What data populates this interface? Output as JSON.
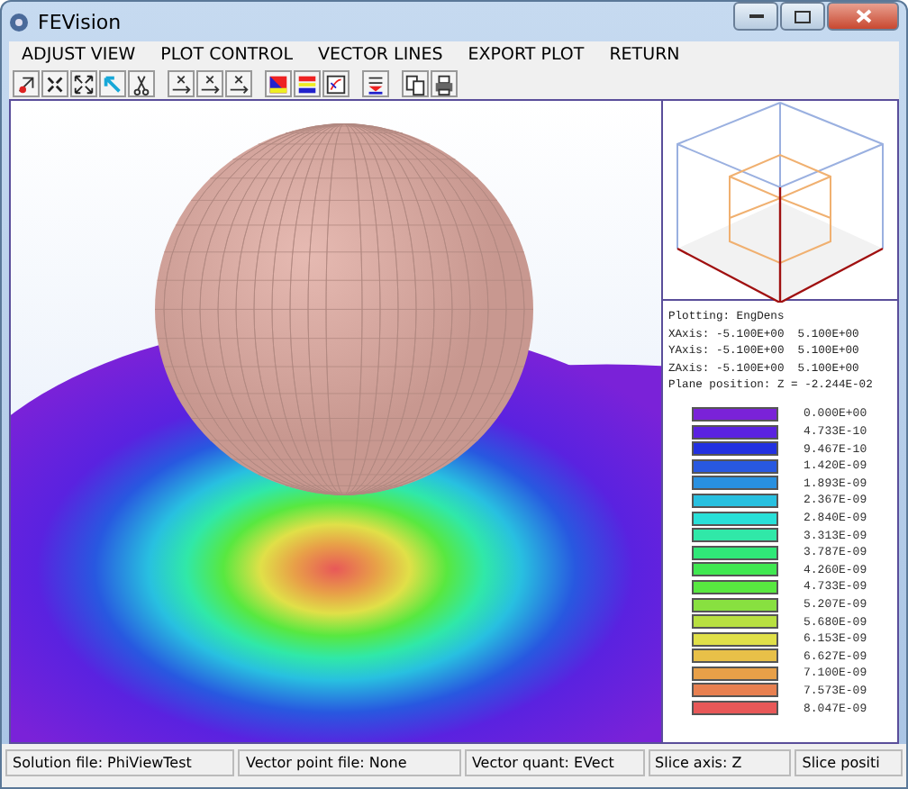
{
  "window": {
    "title": "FEVision"
  },
  "menu": [
    "ADJUST VIEW",
    "PLOT CONTROL",
    "VECTOR LINES",
    "EXPORT PLOT",
    "RETURN"
  ],
  "info": [
    "Plotting: EngDens",
    "XAxis: -5.100E+00  5.100E+00",
    "YAxis: -5.100E+00  5.100E+00",
    "ZAxis: -5.100E+00  5.100E+00",
    "Plane position: Z = -2.244E-02"
  ],
  "legend": [
    {
      "label": "0.000E+00",
      "color": "#7a22d8"
    },
    {
      "label": "4.733E-10",
      "color": "#5a22e0"
    },
    {
      "label": "9.467E-10",
      "color": "#2230e0"
    },
    {
      "label": "1.420E-09",
      "color": "#2858e0"
    },
    {
      "label": "1.893E-09",
      "color": "#2890e0"
    },
    {
      "label": "2.367E-09",
      "color": "#28c0e0"
    },
    {
      "label": "2.840E-09",
      "color": "#28e0d8"
    },
    {
      "label": "3.313E-09",
      "color": "#30e8a8"
    },
    {
      "label": "3.787E-09",
      "color": "#30e878"
    },
    {
      "label": "4.260E-09",
      "color": "#40e850"
    },
    {
      "label": "4.733E-09",
      "color": "#58e840"
    },
    {
      "label": "5.207E-09",
      "color": "#88e040"
    },
    {
      "label": "5.680E-09",
      "color": "#b8e040"
    },
    {
      "label": "6.153E-09",
      "color": "#e0e048"
    },
    {
      "label": "6.627E-09",
      "color": "#e8c048"
    },
    {
      "label": "7.100E-09",
      "color": "#e8a048"
    },
    {
      "label": "7.573E-09",
      "color": "#e88050"
    },
    {
      "label": "8.047E-09",
      "color": "#e85858"
    }
  ],
  "status_bar": [
    "Solution file: PhiViewTest",
    "Vector point file: None",
    "Vector quant: EVect",
    "Slice axis: Z",
    "Slice positi"
  ]
}
